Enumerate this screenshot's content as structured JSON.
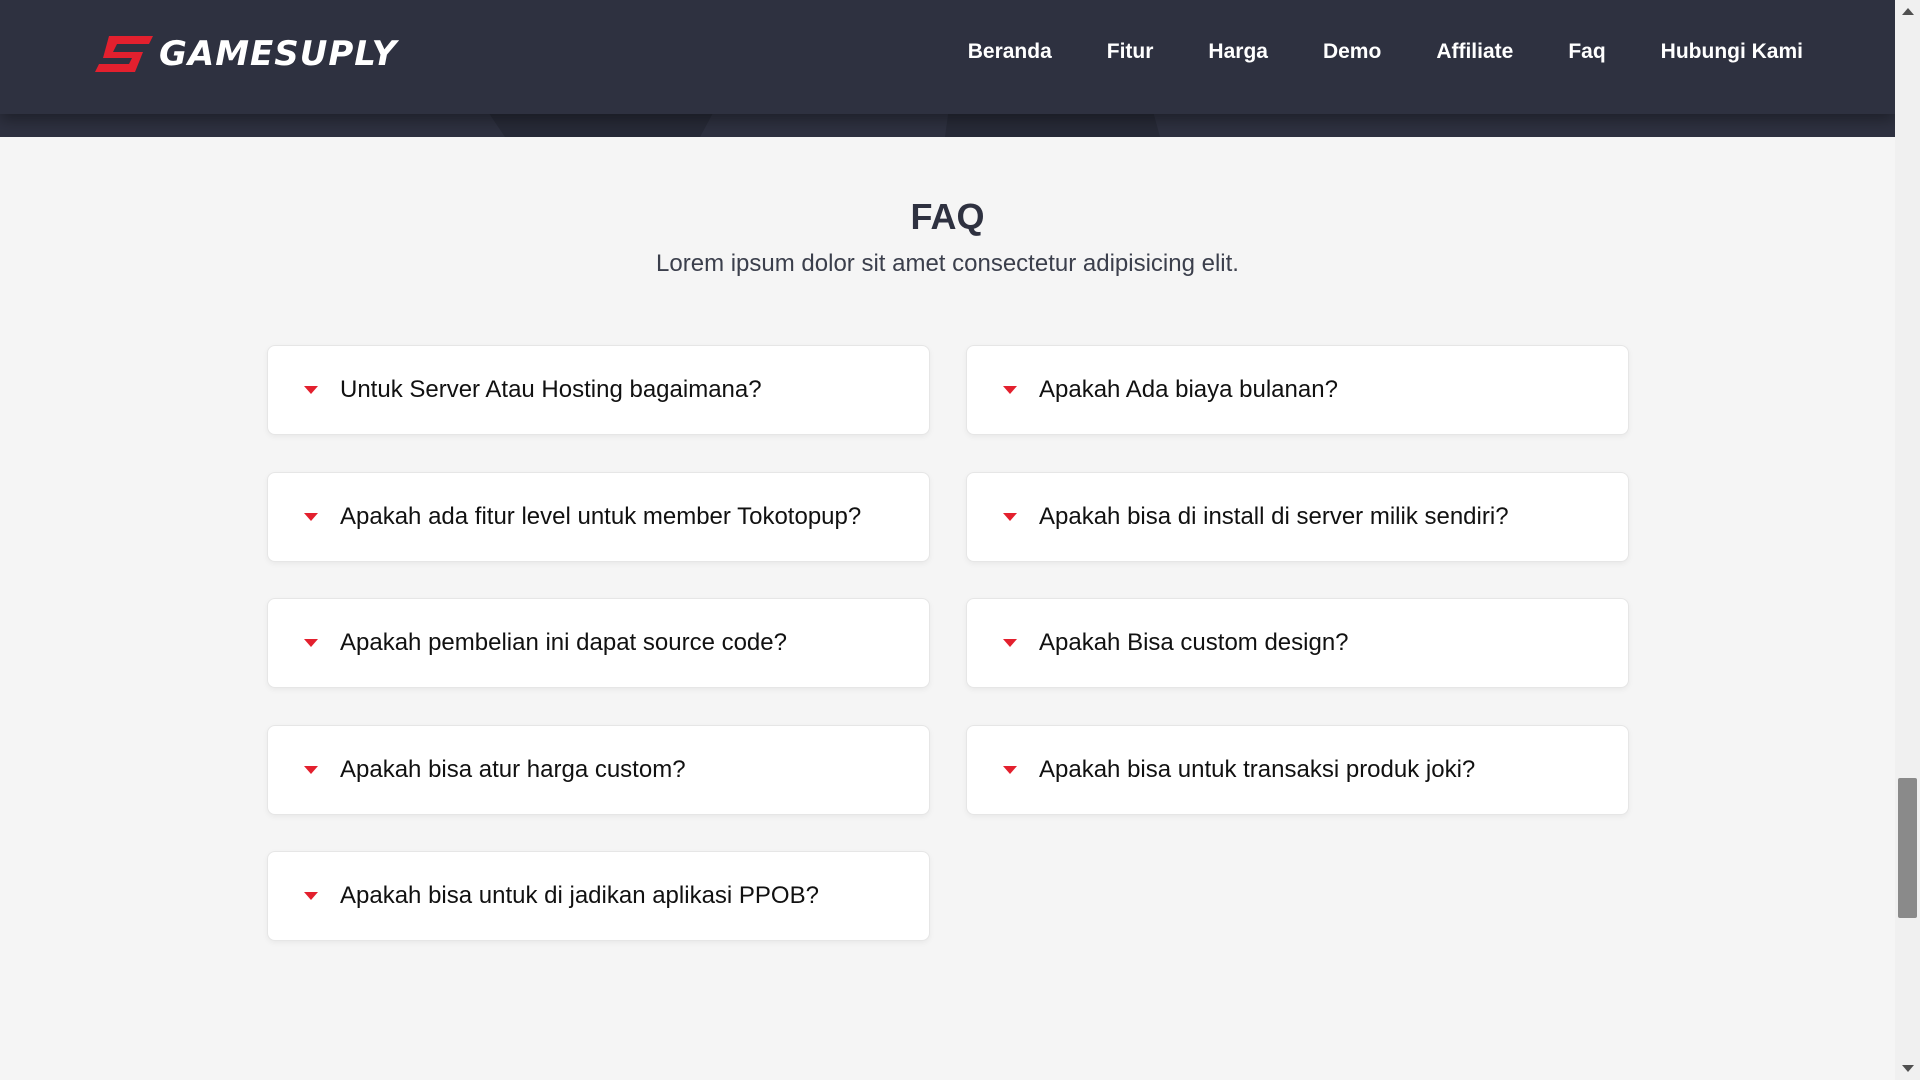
{
  "brand": {
    "name": "GAMESUPLY",
    "accent": "#e3202e",
    "header_bg": "#2e3140"
  },
  "nav": {
    "items": [
      "Beranda",
      "Fitur",
      "Harga",
      "Demo",
      "Affiliate",
      "Faq",
      "Hubungi Kami"
    ]
  },
  "faq": {
    "title": "FAQ",
    "subtitle": "Lorem ipsum dolor sit amet consectetur adipisicing elit.",
    "items": [
      "Untuk Server Atau Hosting bagaimana?",
      "Apakah Ada biaya bulanan?",
      "Apakah ada fitur level untuk member Tokotopup?",
      "Apakah bisa di install di server milik sendiri?",
      "Apakah pembelian ini dapat source code?",
      "Apakah Bisa custom design?",
      "Apakah bisa atur harga custom?",
      "Apakah bisa untuk transaksi produk joki?",
      "Apakah bisa untuk di jadikan aplikasi PPOB?"
    ],
    "caret_icon": "caret-down-icon"
  }
}
